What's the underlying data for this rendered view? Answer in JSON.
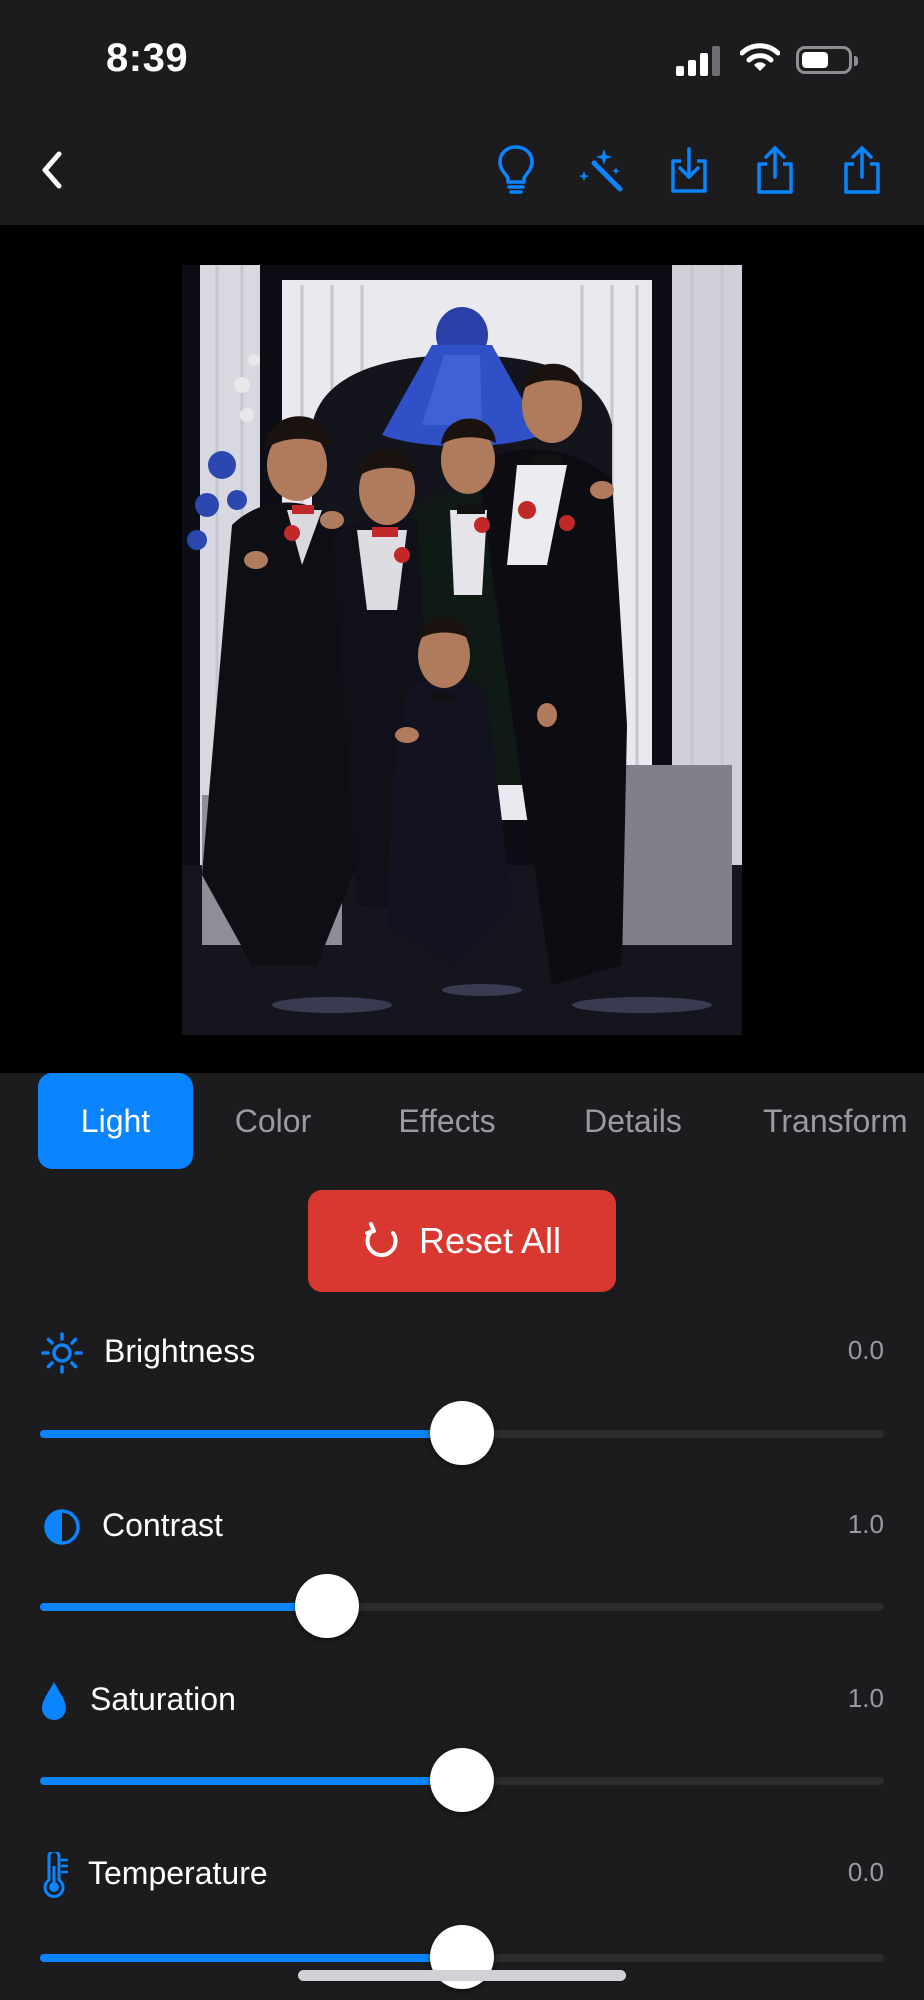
{
  "status_bar": {
    "time": "8:39"
  },
  "toolbar": {
    "icons": [
      "chevron-left-icon",
      "lightbulb-icon",
      "magic-wand-icon",
      "download-icon",
      "share-icon",
      "share-icon"
    ]
  },
  "photo": {
    "description_icon": "photo"
  },
  "tabs": [
    {
      "label": "Light",
      "active": true
    },
    {
      "label": "Color",
      "active": false
    },
    {
      "label": "Effects",
      "active": false
    },
    {
      "label": "Details",
      "active": false
    },
    {
      "label": "Transform",
      "active": false
    }
  ],
  "reset": {
    "label": "Reset All"
  },
  "adjustments": [
    {
      "name": "Brightness",
      "value": "0.0",
      "level": 0.5,
      "icon": "sun-icon"
    },
    {
      "name": "Contrast",
      "value": "1.0",
      "level": 0.34,
      "icon": "contrast-icon"
    },
    {
      "name": "Saturation",
      "value": "1.0",
      "level": 0.5,
      "icon": "drop-icon"
    },
    {
      "name": "Temperature",
      "value": "0.0",
      "level": 0.5,
      "icon": "thermometer-icon"
    }
  ],
  "colors": {
    "accent": "#0a84ff",
    "reset": "#d93830",
    "background": "#1c1c1e"
  }
}
